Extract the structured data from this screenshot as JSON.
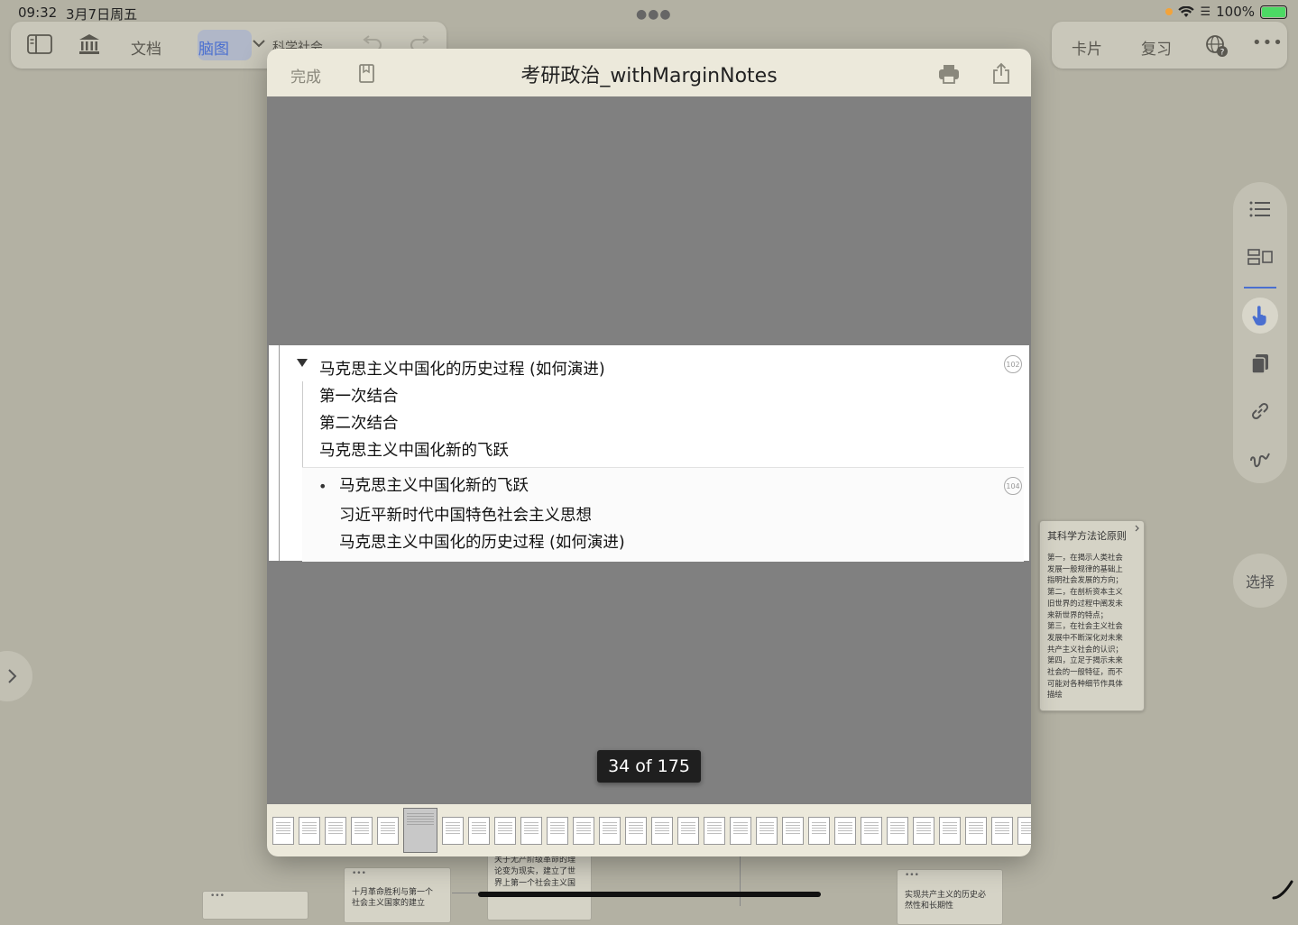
{
  "status_bar": {
    "time": "09:32",
    "date": "3月7日周五",
    "battery": "100%"
  },
  "toolbar_left": {
    "docs_label": "文档",
    "mindmap_label": "脑图",
    "current_notebook": "科学社会"
  },
  "toolbar_right": {
    "cards_label": "卡片",
    "review_label": "复习"
  },
  "side_panel": {
    "select_label": "选择"
  },
  "modal": {
    "done_label": "完成",
    "title": "考研政治_withMarginNotes",
    "page_indicator": "34 of 175",
    "outline": {
      "heading": "马克思主义中国化的历史过程 (如何演进)",
      "badge": "102",
      "items": [
        "第一次结合",
        "第二次结合",
        "马克思主义中国化新的飞跃"
      ],
      "sub_heading": "马克思主义中国化新的飞跃",
      "sub_badge": "104",
      "sub_items": [
        "习近平新时代中国特色社会主义思想",
        "马克思主义中国化的历史过程 (如何演进)"
      ]
    },
    "thumbnail_count": 29,
    "selected_thumbnail": 5
  },
  "note_card": {
    "title": "其科学方法论原则",
    "lines": [
      "第一，在揭示人类社会",
      "发展一般规律的基础上",
      "指明社会发展的方向；",
      "第二，在剖析资本主义",
      "旧世界的过程中阐发未",
      "来新世界的特点；",
      "第三，在社会主义社会",
      "发展中不断深化对未来",
      "共产主义社会的认识；",
      "第四，立足于揭示未来",
      "社会的一般特征，而不",
      "可能对各种细节作具体",
      "描绘"
    ]
  },
  "bottom_cards": {
    "card1_line1": "十月革命胜利与第一个",
    "card1_line2": "社会主义国家的建立",
    "card2_line1": "关于无产阶级革命的理",
    "card2_line2": "论变为现实，建立了世",
    "card2_line3": "界上第一个社会主义国",
    "card3_line1": "实现共产主义的历史必",
    "card3_line2": "然性和长期性"
  }
}
